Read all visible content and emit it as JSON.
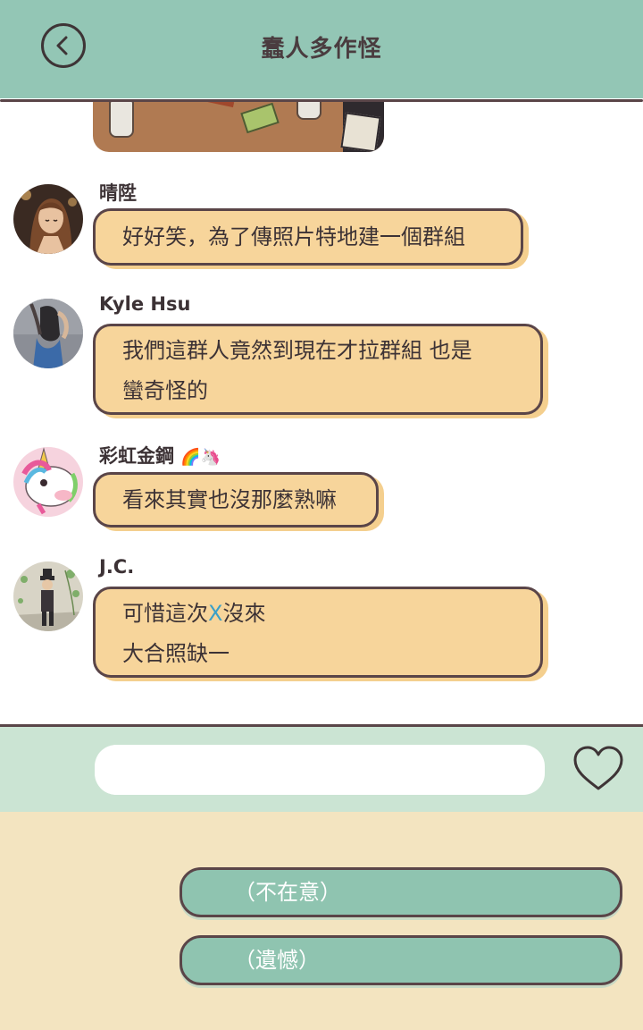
{
  "header": {
    "title": "蠢人多作怪",
    "back_icon": "chevron-left-icon"
  },
  "messages": [
    {
      "sender": "晴陞",
      "text": "好好笑，為了傳照片特地建一個群組"
    },
    {
      "sender": "Kyle Hsu",
      "lines": [
        "我們這群人竟然到現在才拉群組 也是",
        "蠻奇怪的"
      ]
    },
    {
      "sender": "彩虹金鋼",
      "sender_emoji": "🌈🦄",
      "text": "看來其實也沒那麼熟嘛"
    },
    {
      "sender": "J.C.",
      "line1_before": "可惜這次",
      "line1_highlight": "X",
      "line1_after": "沒來",
      "line2": "大合照缺一"
    }
  ],
  "input": {
    "value": "",
    "heart_icon": "heart-icon"
  },
  "choices": [
    "（不在意）",
    "（遺憾）"
  ],
  "colors": {
    "header": "#93c6b5",
    "bubble": "#f7d59b",
    "input_bar": "#cbe4d3",
    "choices_bg": "#f3e4c0",
    "choice_button": "#8fc4b0",
    "highlight": "#3aa0c8"
  }
}
